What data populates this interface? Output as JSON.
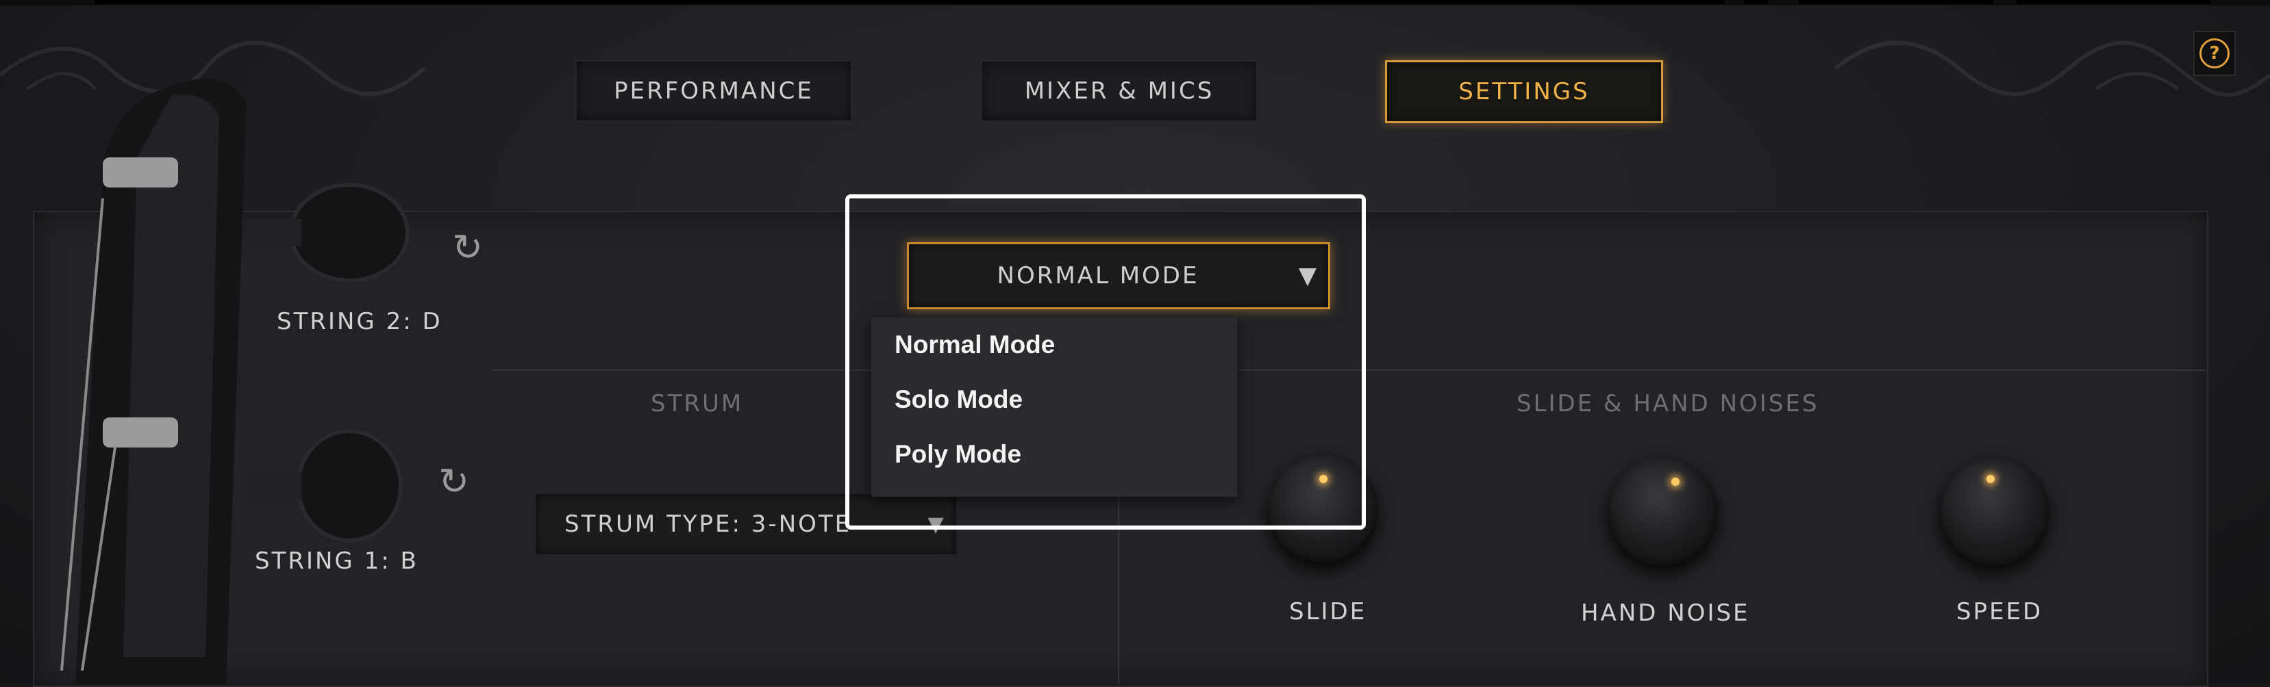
{
  "tabs": [
    {
      "label": "PERFORMANCE",
      "active": false
    },
    {
      "label": "MIXER & MICS",
      "active": false
    },
    {
      "label": "SETTINGS",
      "active": true
    }
  ],
  "help": {
    "icon": "help-icon",
    "glyph": "?"
  },
  "strings": [
    {
      "label": "STRING 2: D"
    },
    {
      "label": "STRING 1: B"
    }
  ],
  "mode_select": {
    "value": "NORMAL MODE",
    "arrow": "▼",
    "options": [
      "Normal Mode",
      "Solo Mode",
      "Poly Mode"
    ]
  },
  "strum": {
    "section_title": "STRUM",
    "type_value": "STRUM TYPE: 3-NOTE",
    "arrow": "▼"
  },
  "slide_section": {
    "title": "SLIDE & HAND NOISES",
    "knobs": [
      {
        "label": "SLIDE"
      },
      {
        "label": "HAND NOISE"
      },
      {
        "label": "SPEED"
      }
    ]
  },
  "colors": {
    "accent": "#e1a03c",
    "highlight_box": "#ffffff",
    "background": "#1c1c20"
  },
  "icons": {
    "tune_arrow": "↻"
  }
}
